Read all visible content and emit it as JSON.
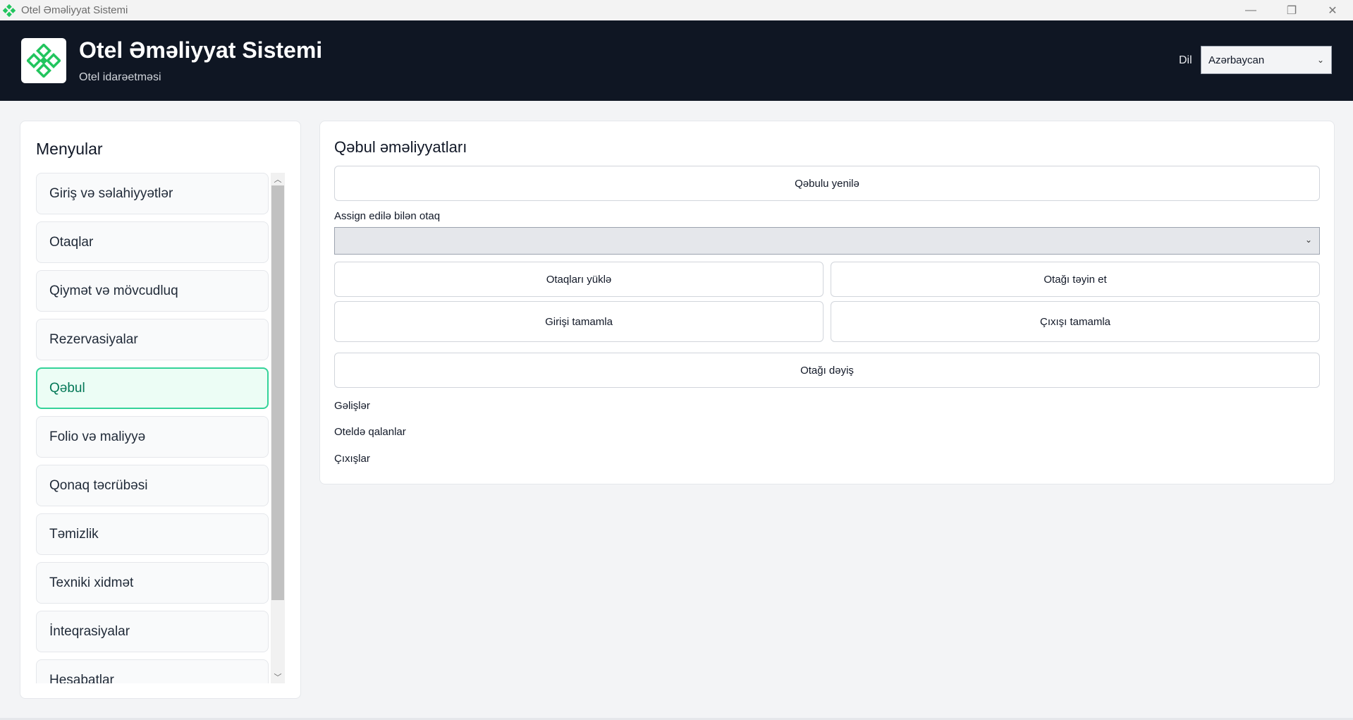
{
  "window": {
    "title": "Otel Əməliyyat Sistemi",
    "controls": [
      "—",
      "❐",
      "✕"
    ]
  },
  "header": {
    "title": "Otel Əməliyyat Sistemi",
    "subtitle": "Otel idarəetməsi",
    "language_label": "Dil",
    "language_value": "Azərbaycan"
  },
  "sidebar": {
    "title": "Menyular",
    "items": [
      {
        "label": "Giriş və səlahiyyətlər"
      },
      {
        "label": "Otaqlar"
      },
      {
        "label": "Qiymət və mövcudluq"
      },
      {
        "label": "Rezervasiyalar"
      },
      {
        "label": "Qəbul",
        "active": true
      },
      {
        "label": "Folio və maliyyə"
      },
      {
        "label": "Qonaq təcrübəsi"
      },
      {
        "label": "Təmizlik"
      },
      {
        "label": "Texniki xidmət"
      },
      {
        "label": "İnteqrasiyalar"
      },
      {
        "label": "Hesabatlar"
      }
    ]
  },
  "main": {
    "title": "Qəbul əməliyyatları",
    "refresh_button": "Qəbulu yenilə",
    "room_select_label": "Assign edilə bilən otaq",
    "room_select_value": "",
    "load_rooms_button": "Otaqları yüklə",
    "assign_room_button": "Otağı təyin et",
    "complete_checkin_button": "Girişi tamamla",
    "complete_checkout_button": "Çıxışı tamamla",
    "change_room_button": "Otağı dəyiş",
    "arrivals_label": "Gəlişlər",
    "in_house_label": "Oteldə qalanlar",
    "departures_label": "Çıxışlar"
  },
  "colors": {
    "header_bg": "#0f1623",
    "accent": "#34d399",
    "active_text": "#047857",
    "logo_green": "#22c55e"
  },
  "icons": {
    "app": "diamond-logo-icon",
    "dropdown": "chevron-down-icon"
  }
}
